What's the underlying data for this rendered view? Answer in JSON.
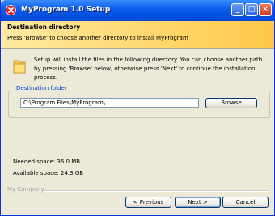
{
  "window": {
    "title": "MyProgram 1.0 Setup"
  },
  "header": {
    "title": "Destination directory",
    "subtitle": "Press 'Browse' to choose another directory to install MyProgram"
  },
  "main": {
    "intro": "Setup will install the files in the following directory. You can choose another path by pressing 'Browse' below, otherwise press 'Next' to continue the installation process.",
    "folder_group_label": "Destination folder",
    "folder_path": "C:\\Program Files\\MyProgram\\",
    "browse_label": "Browse",
    "needed_space": "Needed space: 36.0 MB",
    "available_space": "Available space: 24.3 GB"
  },
  "footer": {
    "company": "My Company",
    "prev_label": "< Previous",
    "next_label": "Next >",
    "cancel_label": "Cancel"
  },
  "colors": {
    "titlebar": "#0A5BEA",
    "header_gradient_end": "#FFC84A",
    "group_label": "#0046D5",
    "close_button": "#D5371C"
  },
  "icons": [
    "app-icon",
    "minimize-icon",
    "maximize-icon",
    "close-icon",
    "folder-icon"
  ]
}
